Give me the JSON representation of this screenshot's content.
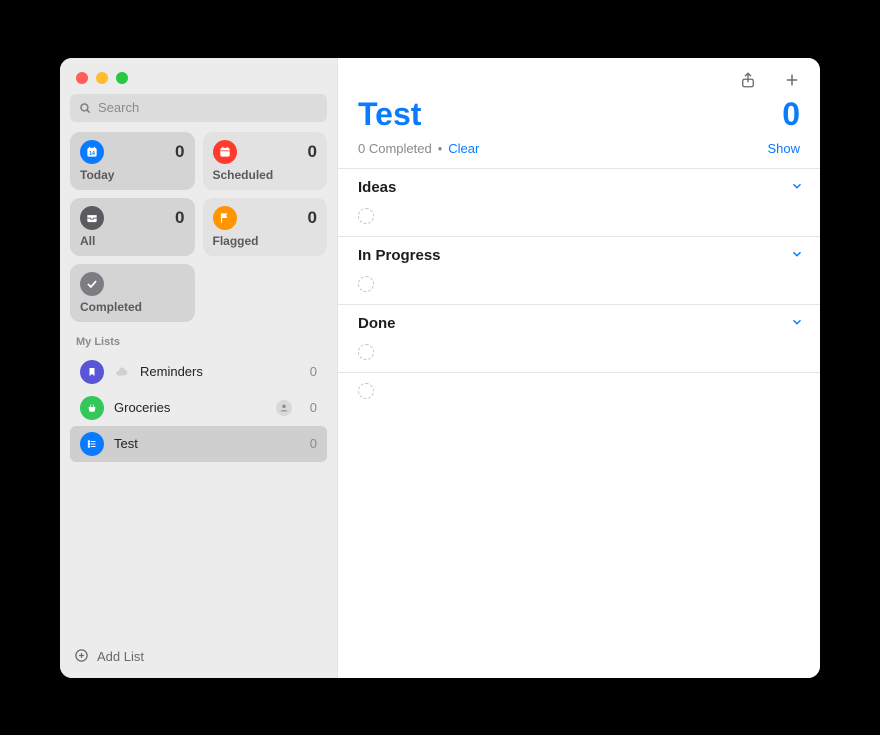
{
  "search": {
    "placeholder": "Search"
  },
  "smart": {
    "today": {
      "label": "Today",
      "count": 0,
      "color": "#0a7aff"
    },
    "scheduled": {
      "label": "Scheduled",
      "count": 0,
      "color": "#ff3b30"
    },
    "all": {
      "label": "All",
      "count": 0,
      "color": "#5b5b5f"
    },
    "flagged": {
      "label": "Flagged",
      "count": 0,
      "color": "#ff9500"
    },
    "completed": {
      "label": "Completed",
      "color": "#7d7d81"
    }
  },
  "lists_header": "My Lists",
  "lists": [
    {
      "name": "Reminders",
      "count": 0,
      "color": "#5856d6",
      "cloud": true
    },
    {
      "name": "Groceries",
      "count": 0,
      "color": "#34c759",
      "shared": true
    },
    {
      "name": "Test",
      "count": 0,
      "color": "#0a7aff",
      "selected": true
    }
  ],
  "add_list_label": "Add List",
  "main": {
    "title": "Test",
    "count": 0,
    "completed_text": "0 Completed",
    "clear_label": "Clear",
    "show_label": "Show",
    "sections": [
      {
        "title": "Ideas"
      },
      {
        "title": "In Progress"
      },
      {
        "title": "Done"
      }
    ]
  }
}
